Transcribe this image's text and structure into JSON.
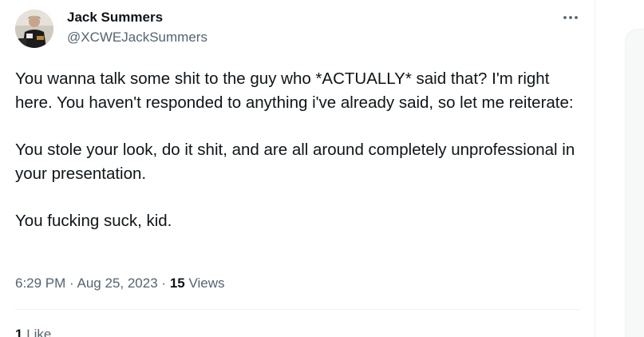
{
  "author": {
    "name": "Jack Summers",
    "handle": "@XCWEJackSummers"
  },
  "post": {
    "paragraphs": [
      "You wanna talk some shit to the guy who *ACTUALLY* said that? I'm right here. You haven't responded to anything i've already said, so let me reiterate:",
      "You stole your look, do it shit, and are all around completely unprofessional in your presentation.",
      "You fucking suck, kid."
    ],
    "time": "6:29 PM",
    "separator": "·",
    "date": "Aug 25, 2023",
    "views_count": "15",
    "views_label": "Views"
  },
  "stats": {
    "likes_count": "1",
    "likes_label": "Like"
  },
  "icons": {
    "more": "more-horizontal-icon"
  },
  "colors": {
    "text": "#0f1419",
    "secondary": "#536471",
    "divider": "#eff3f4"
  }
}
